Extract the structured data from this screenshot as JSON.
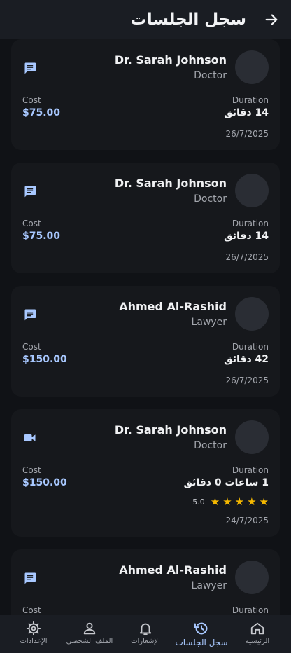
{
  "app_bar": {
    "title": "سجل الجلسات"
  },
  "labels": {
    "cost": "Cost",
    "duration": "Duration"
  },
  "sessions": [
    {
      "name": "Dr. Sarah Johnson",
      "role": "Doctor",
      "type": "chat",
      "cost": "$75.00",
      "duration": "14 دقائق",
      "date": "26/7/2025"
    },
    {
      "name": "Dr. Sarah Johnson",
      "role": "Doctor",
      "type": "chat",
      "cost": "$75.00",
      "duration": "14 دقائق",
      "date": "26/7/2025"
    },
    {
      "name": "Ahmed Al-Rashid",
      "role": "Lawyer",
      "type": "chat",
      "cost": "$150.00",
      "duration": "42 دقائق",
      "date": "26/7/2025"
    },
    {
      "name": "Dr. Sarah Johnson",
      "role": "Doctor",
      "type": "video",
      "cost": "$150.00",
      "duration": "1 ساعات 0 دقائق",
      "date": "24/7/2025",
      "rating": "5.0",
      "stars": 5
    },
    {
      "name": "Ahmed Al-Rashid",
      "role": "Lawyer",
      "type": "chat",
      "cost": "",
      "duration": "",
      "date": ""
    }
  ],
  "bottom_nav": [
    {
      "label": "الإعدادات",
      "icon": "gear-icon"
    },
    {
      "label": "الملف الشخصي",
      "icon": "person-icon"
    },
    {
      "label": "الإشعارات",
      "icon": "bell-icon"
    },
    {
      "label": "سجل الجلسات",
      "icon": "history-icon",
      "active": true
    },
    {
      "label": "الرئيسية",
      "icon": "home-icon"
    }
  ],
  "colors": {
    "accent": "#a8c8ff",
    "star": "#f5b800",
    "background": "#101216",
    "card": "#16181c"
  }
}
